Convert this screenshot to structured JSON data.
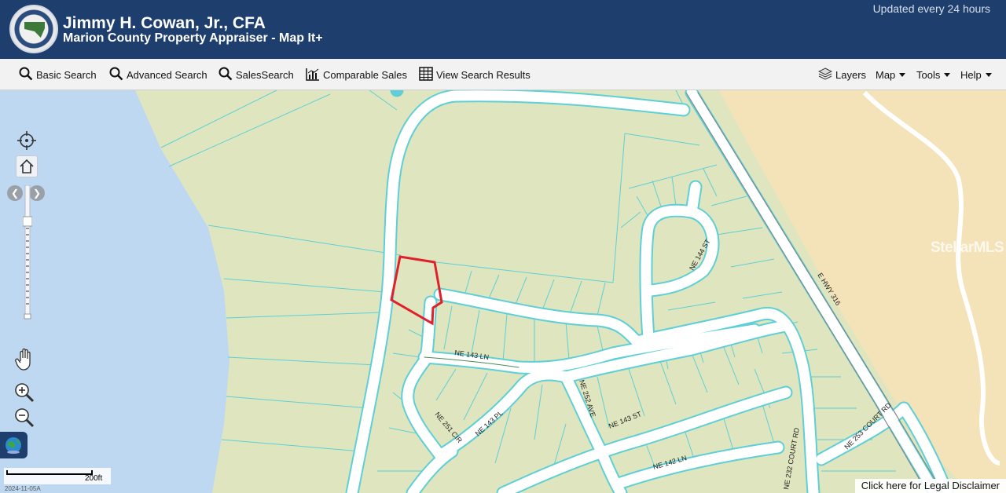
{
  "header": {
    "title": "Jimmy H. Cowan, Jr., CFA",
    "subtitle": "Marion County Property Appraiser - Map It+",
    "updated": "Updated every 24 hours"
  },
  "toolbar": {
    "basic_search": "Basic Search",
    "advanced_search": "Advanced Search",
    "sales_search": "SalesSearch",
    "comparable_sales": "Comparable Sales",
    "view_search_results": "View Search Results",
    "layers": "Layers",
    "map": "Map",
    "tools": "Tools",
    "help": "Help"
  },
  "map": {
    "road_labels": [
      "NE 143 LN",
      "NE 144 ST",
      "E HWY 316",
      "NE 252 AVE",
      "NE 143 ST",
      "NE 143 PL",
      "NE 251 CIR",
      "NE 142 LN",
      "NE 232 COURT RD",
      "NE 253 COURT RD"
    ],
    "scale_label": "200ft",
    "date_label": "2024-11-05A",
    "disclaimer": "Click here for Legal Disclaimer",
    "watermark": "StellarMLS",
    "colors": {
      "water": "#bed8f2",
      "land": "#dfe6bf",
      "open_land": "#f4e2b8",
      "parcel_lines": "#5ecfd6",
      "selected_parcel": "#e0202a",
      "header": "#1e3f6e"
    }
  }
}
